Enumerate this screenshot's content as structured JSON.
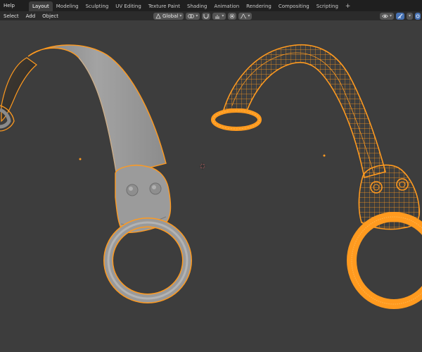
{
  "topbar": {
    "menus": [
      "Help"
    ],
    "tabs": [
      {
        "label": "Layout",
        "active": true
      },
      {
        "label": "Modeling",
        "active": false
      },
      {
        "label": "Sculpting",
        "active": false
      },
      {
        "label": "UV Editing",
        "active": false
      },
      {
        "label": "Texture Paint",
        "active": false
      },
      {
        "label": "Shading",
        "active": false
      },
      {
        "label": "Animation",
        "active": false
      },
      {
        "label": "Rendering",
        "active": false
      },
      {
        "label": "Compositing",
        "active": false
      },
      {
        "label": "Scripting",
        "active": false
      }
    ],
    "add_tab": "+"
  },
  "viewport_header": {
    "menus": {
      "select": "Select",
      "add": "Add",
      "object": "Object"
    },
    "orientation": "Global"
  },
  "colors": {
    "selection_orange": "#ff9a1f",
    "viewport_bg": "#3d3d3d",
    "topbar_bg": "#1f1f1f",
    "active_blue": "#4772b3"
  }
}
